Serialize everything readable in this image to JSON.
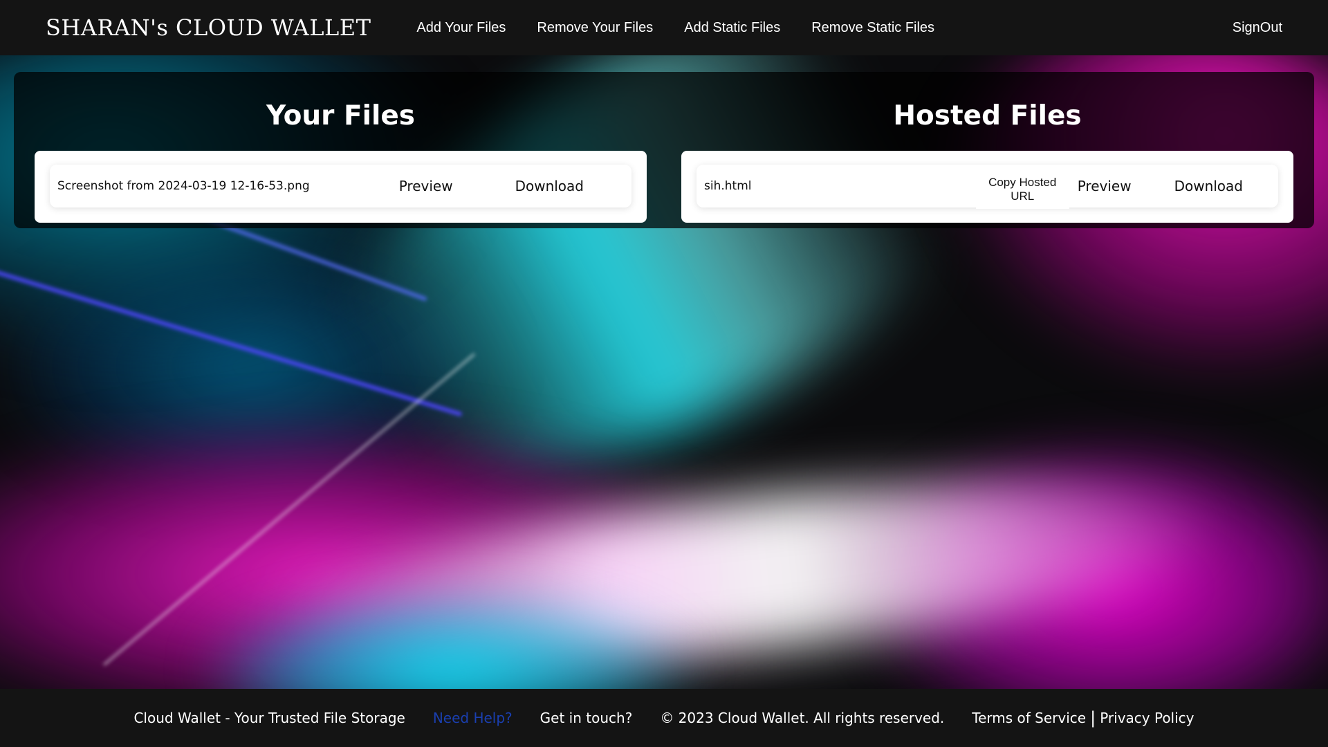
{
  "navbar": {
    "brand": "SHARAN's CLOUD WALLET",
    "links": [
      "Add Your Files",
      "Remove Your Files",
      "Add Static Files",
      "Remove Static Files"
    ],
    "signout": "SignOut"
  },
  "your_files": {
    "title": "Your Files",
    "items": [
      {
        "name": "Screenshot from 2024-03-19 12-16-53.png",
        "preview": "Preview",
        "download": "Download"
      }
    ]
  },
  "hosted_files": {
    "title": "Hosted Files",
    "items": [
      {
        "name": "sih.html",
        "copy_url": "Copy Hosted URL",
        "preview": "Preview",
        "download": "Download"
      }
    ]
  },
  "footer": {
    "tagline": "Cloud Wallet - Your Trusted File Storage",
    "help": "Need Help?",
    "contact": "Get in touch?",
    "copyright": "© 2023 Cloud Wallet. All rights reserved.",
    "terms": "Terms of Service",
    "separator": "|",
    "privacy": "Privacy Policy"
  },
  "colors": {
    "navbar_bg": "#141414",
    "help_link": "#1a3fb0",
    "card_bg": "#ffffff"
  }
}
